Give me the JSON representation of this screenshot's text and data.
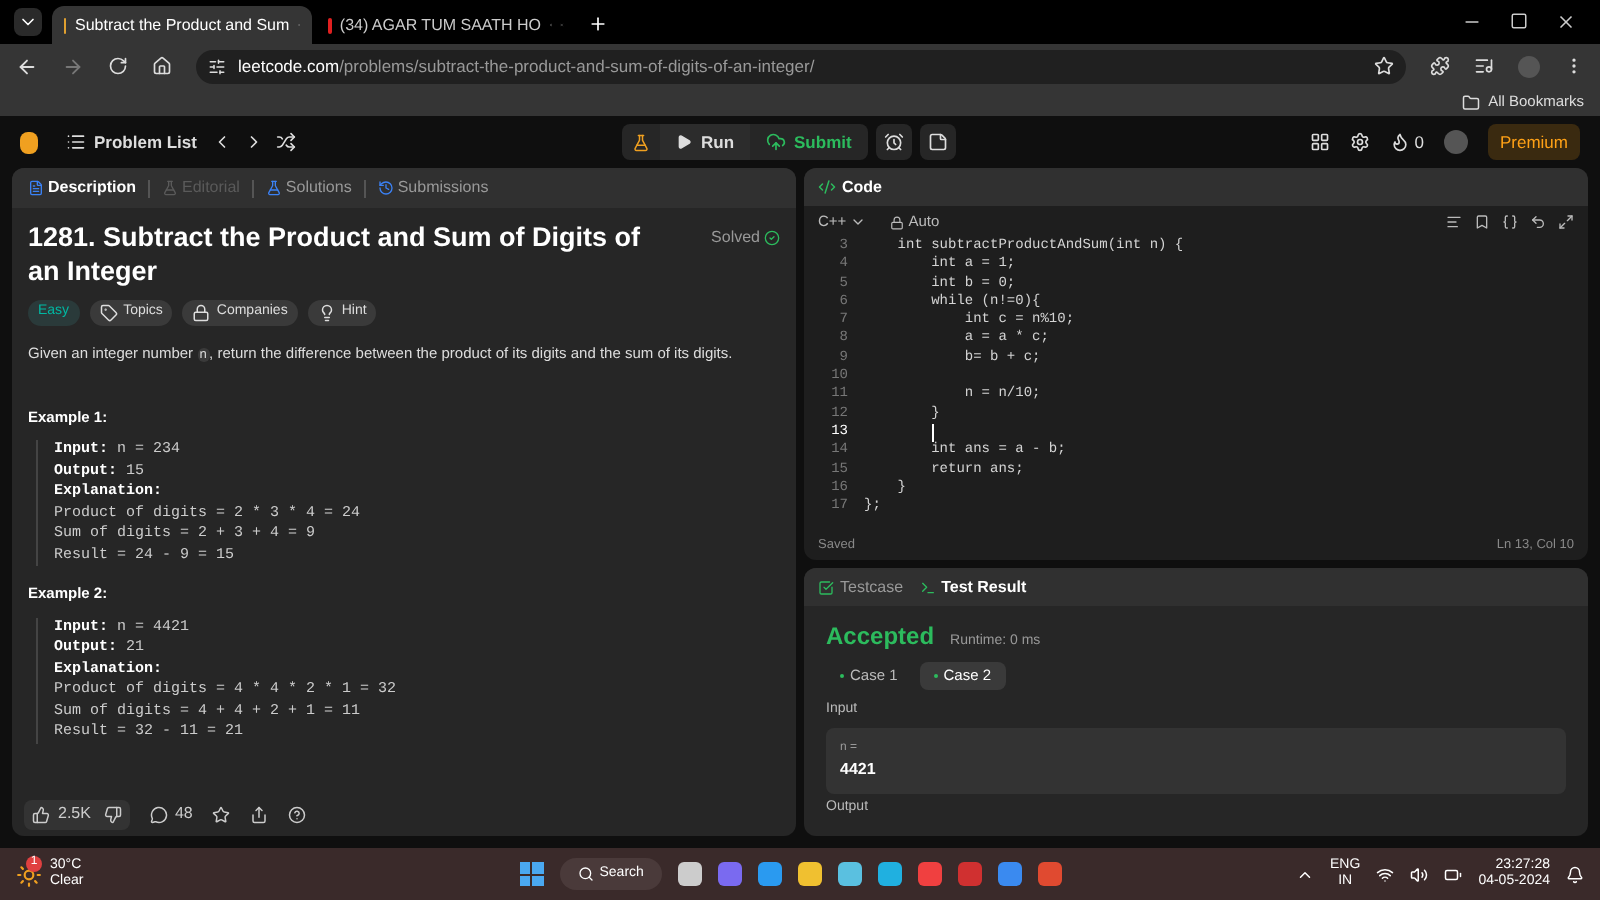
{
  "browser": {
    "tabs": [
      {
        "title": "Subtract the Product and Sum",
        "selected": true,
        "audio": false
      },
      {
        "title": "(34) AGAR TUM SAATH HO",
        "selected": false,
        "audio": true
      }
    ],
    "url_host": "leetcode.com",
    "url_path": "/problems/subtract-the-product-and-sum-of-digits-of-an-integer/",
    "bookmarks": "All Bookmarks"
  },
  "nav": {
    "problem_list": "Problem List",
    "run": "Run",
    "submit": "Submit",
    "streak": "0",
    "premium": "Premium"
  },
  "left": {
    "tabs": [
      {
        "label": "Description",
        "selected": true,
        "disabled": false
      },
      {
        "label": "Editorial",
        "selected": false,
        "disabled": true
      },
      {
        "label": "Solutions",
        "selected": false,
        "disabled": false
      },
      {
        "label": "Submissions",
        "selected": false,
        "disabled": false
      }
    ],
    "title": "1281. Subtract the Product and Sum of Digits of an Integer",
    "status": "Solved",
    "tags": [
      {
        "label": "Easy",
        "kind": "difficulty"
      },
      {
        "label": "Topics",
        "kind": "topics"
      },
      {
        "label": "Companies",
        "kind": "companies"
      },
      {
        "label": "Hint",
        "kind": "hint"
      }
    ],
    "description": {
      "before": "Given an integer number ",
      "code": "n",
      "after": ", return the difference between the product of its digits and the sum of its digits."
    },
    "examples": [
      {
        "title": "Example 1:",
        "lines": [
          {
            "label": "Input:",
            "value": "n = 234"
          },
          {
            "label": "Output:",
            "value": "15"
          },
          {
            "label": "Explanation:"
          },
          {
            "value": "Product of digits = 2 * 3 * 4 = 24"
          },
          {
            "value": "Sum of digits = 2 + 3 + 4 = 9"
          },
          {
            "value": "Result = 24 - 9 = 15"
          }
        ]
      },
      {
        "title": "Example 2:",
        "lines": [
          {
            "label": "Input:",
            "value": "n = 4421"
          },
          {
            "label": "Output:",
            "value": "21"
          },
          {
            "label": "Explanation:"
          },
          {
            "value": "Product of digits = 4 * 4 * 2 * 1 = 32"
          },
          {
            "value": "Sum of digits = 4 + 4 + 2 + 1 = 11"
          },
          {
            "value": "Result = 32 - 11 = 21"
          }
        ]
      }
    ],
    "likes": "2.5K",
    "comments": "48"
  },
  "code": {
    "title": "Code",
    "language": "C++",
    "mode": "Auto",
    "lines": [
      {
        "number": "3",
        "text": "    int subtractProductAndSum(int n) {"
      },
      {
        "number": "4",
        "text": "        int a = 1;"
      },
      {
        "number": "5",
        "text": "        int b = 0;"
      },
      {
        "number": "6",
        "text": "        while (n!=0){"
      },
      {
        "number": "7",
        "text": "            int c = n%10;"
      },
      {
        "number": "8",
        "text": "            a = a * c;"
      },
      {
        "number": "9",
        "text": "            b= b + c;"
      },
      {
        "number": "10"
      },
      {
        "number": "11",
        "text": "            n = n/10;"
      },
      {
        "number": "12",
        "text": "        }"
      },
      {
        "number": "13",
        "current": true
      },
      {
        "number": "14",
        "text": "        int ans = a - b;"
      },
      {
        "number": "15",
        "text": "        return ans;"
      },
      {
        "number": "16",
        "text": "    }"
      },
      {
        "number": "17",
        "text": "};"
      }
    ],
    "saved": "Saved",
    "position": "Ln 13, Col 10"
  },
  "result": {
    "tabs": [
      {
        "label": "Testcase",
        "selected": false
      },
      {
        "label": "Test Result",
        "selected": true
      }
    ],
    "verdict": "Accepted",
    "runtime": "Runtime: 0 ms",
    "cases": [
      {
        "label": "Case 1",
        "selected": false
      },
      {
        "label": "Case 2",
        "selected": true
      }
    ],
    "input_label": "Input",
    "var": "n =",
    "value": "4421",
    "output_label": "Output"
  },
  "taskbar": {
    "temperature": "30°C",
    "weather": "Clear",
    "badge": "1",
    "search": "Search",
    "lang1": "ENG",
    "lang2": "IN",
    "time": "23:27:28",
    "date": "04-05-2024"
  }
}
